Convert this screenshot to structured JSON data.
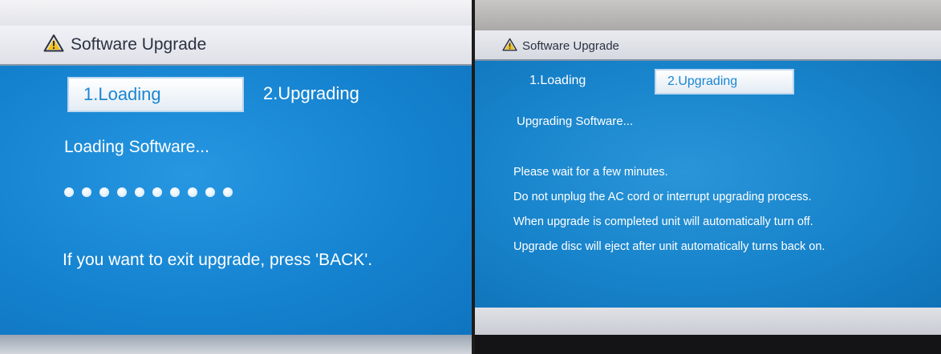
{
  "left_screen": {
    "title": "Software Upgrade",
    "title_icon": "warning-triangle-icon",
    "steps": [
      {
        "label": "1.Loading",
        "active": true
      },
      {
        "label": "2.Upgrading",
        "active": false
      }
    ],
    "status": "Loading Software...",
    "progress_dots": 10,
    "exit_hint": "If you want to exit upgrade, press 'BACK'."
  },
  "right_screen": {
    "title": "Software Upgrade",
    "title_icon": "warning-triangle-icon",
    "steps": [
      {
        "label": "1.Loading",
        "active": false
      },
      {
        "label": "2.Upgrading",
        "active": true
      }
    ],
    "status": "Upgrading Software...",
    "messages": [
      "Please wait for a few minutes.",
      "Do not unplug the AC cord or interrupt upgrading process.",
      "When upgrade is completed unit will automatically turn off.",
      "Upgrade disc will eject after unit automatically turns back on."
    ]
  },
  "colors": {
    "screen_blue": "#178ad6",
    "active_tab_text": "#1a86d2",
    "header_bg": "#e4e6ec",
    "text_white": "#ffffff"
  }
}
